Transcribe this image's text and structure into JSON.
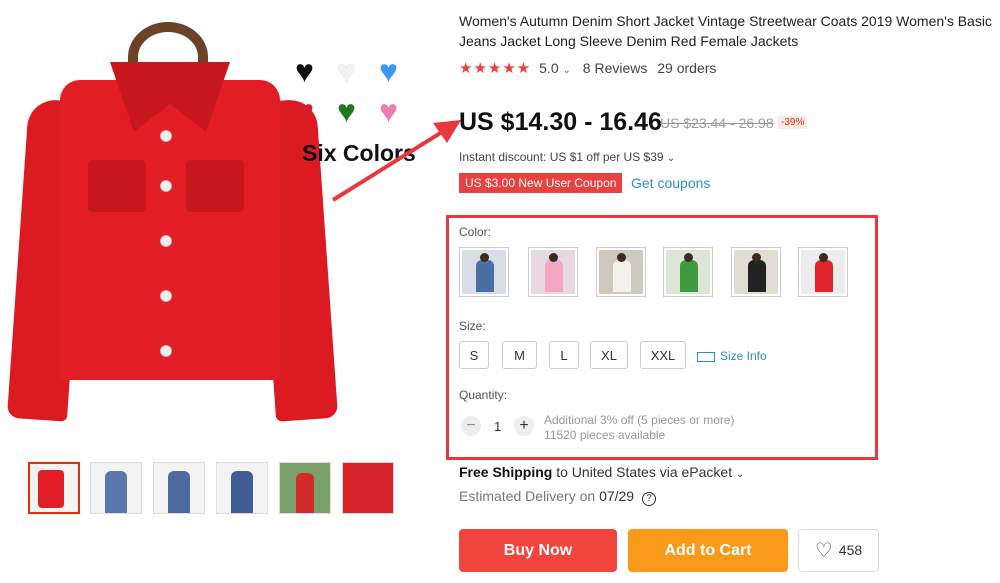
{
  "product": {
    "title": "Women's Autumn Denim Short Jacket Vintage Streetwear Coats 2019 Women's Basic Jeans Jacket Long Sleeve Denim Red Female Jackets",
    "rating_value": "5.0",
    "reviews": "8 Reviews",
    "orders": "29 orders",
    "star_count": 5
  },
  "image_overlay": {
    "caption": "Six Colors",
    "hearts": [
      {
        "color": "#111111",
        "icon": "heart-icon"
      },
      {
        "color": "#f2f2f2",
        "icon": "heart-icon"
      },
      {
        "color": "#3a98f0",
        "icon": "heart-icon"
      },
      {
        "color": "#d81c2a",
        "icon": "heart-icon"
      },
      {
        "color": "#1f7a1f",
        "icon": "heart-icon"
      },
      {
        "color": "#f27bb0",
        "icon": "heart-icon"
      }
    ]
  },
  "pricing": {
    "price": "US $14.30 - 16.46",
    "original_price": "US $23.44 - 26.98",
    "discount": "-39%",
    "instant_discount": "Instant discount: US $1 off per US $39",
    "coupon": "US $3.00 New User Coupon",
    "get_coupons": "Get coupons"
  },
  "sku": {
    "color_label": "Color:",
    "size_label": "Size:",
    "sizes": [
      "S",
      "M",
      "L",
      "XL",
      "XXL"
    ],
    "size_info": "Size Info",
    "quantity_label": "Quantity:",
    "quantity": "1",
    "qty_note_1": "Additional 3% off (5 pieces or more)",
    "qty_note_2": "11520 pieces available",
    "colors": [
      {
        "name": "blue denim",
        "shirt": "#4a6fa5",
        "bg": "#d9dde6"
      },
      {
        "name": "pink",
        "shirt": "#f2a6c4",
        "bg": "#e6d9df"
      },
      {
        "name": "white",
        "shirt": "#f4f1ea",
        "bg": "#cfc8bf"
      },
      {
        "name": "green",
        "shirt": "#3e9a3e",
        "bg": "#dfe6d9"
      },
      {
        "name": "black",
        "shirt": "#222222",
        "bg": "#e2ddd4"
      },
      {
        "name": "red",
        "shirt": "#e0242c",
        "bg": "#ececec"
      }
    ]
  },
  "shipping": {
    "free_shipping": "Free Shipping",
    "destination": "to United States via ePacket",
    "estimated_label": "Estimated Delivery on",
    "estimated_date": "07/29"
  },
  "actions": {
    "buy_now": "Buy Now",
    "add_to_cart": "Add to Cart",
    "wishlist_count": "458"
  },
  "colors": {
    "accent_red": "#f1453d",
    "accent_orange": "#fa9a1b",
    "link_blue": "#2a8cce",
    "annotation_red": "#e8383d"
  }
}
